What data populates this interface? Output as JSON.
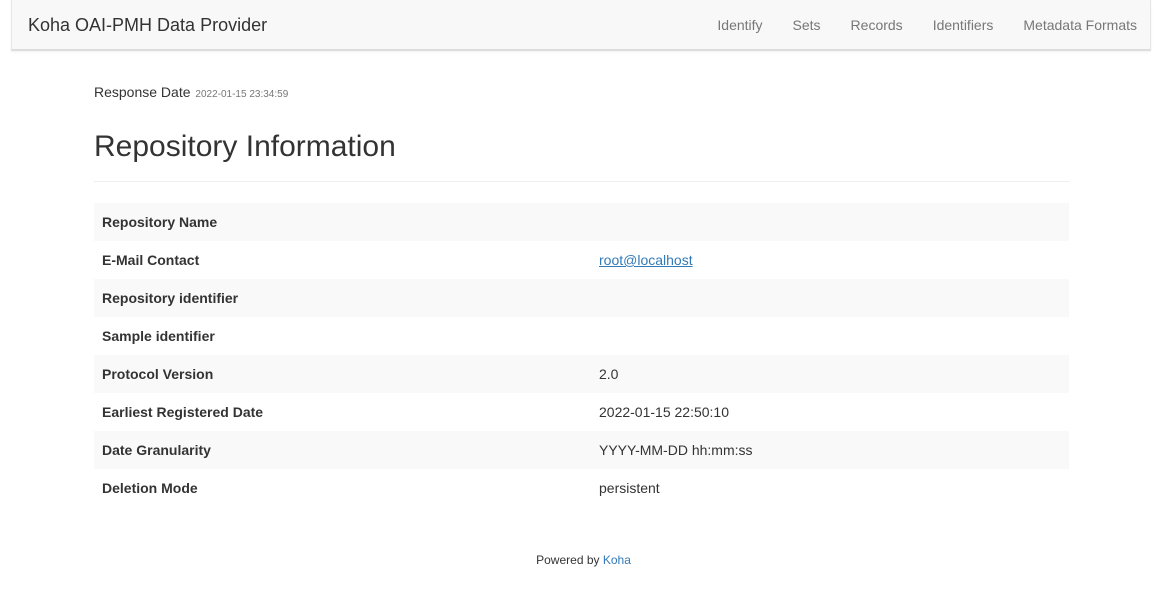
{
  "navbar": {
    "brand": "Koha OAI-PMH Data Provider",
    "links": [
      "Identify",
      "Sets",
      "Records",
      "Identifiers",
      "Metadata Formats"
    ]
  },
  "response": {
    "label": "Response Date",
    "value": "2022-01-15 23:34:59"
  },
  "page_title": "Repository Information",
  "table": [
    {
      "key": "Repository Name",
      "value": ""
    },
    {
      "key": "E-Mail Contact",
      "value": "root@localhost"
    },
    {
      "key": "Repository identifier",
      "value": ""
    },
    {
      "key": "Sample identifier",
      "value": ""
    },
    {
      "key": "Protocol Version",
      "value": "2.0"
    },
    {
      "key": "Earliest Registered Date",
      "value": "2022-01-15 22:50:10"
    },
    {
      "key": "Date Granularity",
      "value": "YYYY-MM-DD hh:mm:ss"
    },
    {
      "key": "Deletion Mode",
      "value": "persistent"
    }
  ],
  "footer": {
    "prefix": "Powered by",
    "link": "Koha"
  },
  "colors": {
    "link": "#337ab7",
    "navbar_bg": "#f8f8f8",
    "row_stripe": "#f9f9f9"
  }
}
